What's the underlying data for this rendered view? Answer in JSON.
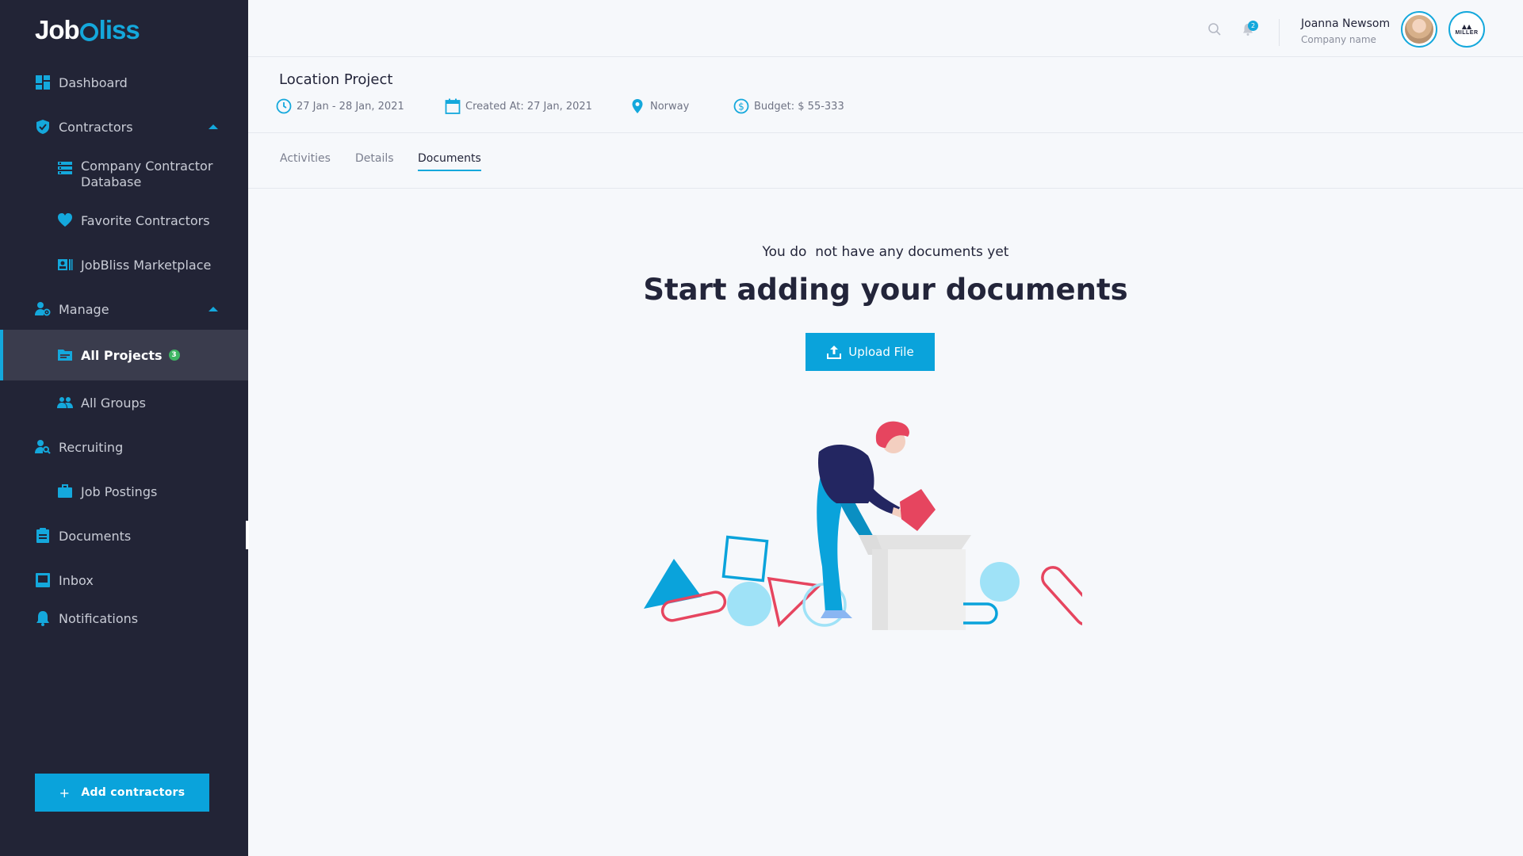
{
  "brand": {
    "name_part1": "Job",
    "name_part2": "liss"
  },
  "sidebar": {
    "items": [
      {
        "label": "Dashboard",
        "icon": "dashboard-icon"
      },
      {
        "label": "Contractors",
        "icon": "shield-icon",
        "expanded": true
      },
      {
        "label": "Company Contractor Database",
        "icon": "database-icon"
      },
      {
        "label": "Favorite Contractors",
        "icon": "heart-icon"
      },
      {
        "label": "JobBliss Marketplace",
        "icon": "id-card-icon"
      },
      {
        "label": "Manage",
        "icon": "user-gear-icon",
        "expanded": true
      },
      {
        "label": "All Projects",
        "icon": "folder-icon",
        "badge": "3",
        "active": true
      },
      {
        "label": "All Groups",
        "icon": "group-icon"
      },
      {
        "label": "Recruiting",
        "icon": "user-search-icon"
      },
      {
        "label": "Job Postings",
        "icon": "briefcase-icon"
      },
      {
        "label": "Documents",
        "icon": "clipboard-icon"
      },
      {
        "label": "Inbox",
        "icon": "inbox-icon"
      },
      {
        "label": "Notifications",
        "icon": "bell-icon"
      }
    ],
    "add_button": {
      "plus": "+",
      "label": "Add contractors"
    }
  },
  "header": {
    "notification_count": "2",
    "user_name": "Joanna Newsom",
    "company_name": "Company name",
    "company_logo_text": "MILLER"
  },
  "project": {
    "title": "Location Project",
    "dates": "27 Jan - 28 Jan, 2021",
    "created": "Created At: 27 Jan, 2021",
    "location": "Norway",
    "budget": "Budget: $ 55-333"
  },
  "tabs": [
    {
      "label": "Activities"
    },
    {
      "label": "Details"
    },
    {
      "label": "Documents",
      "active": true
    }
  ],
  "empty_state": {
    "subtitle": "You do  not have any documents yet",
    "title": "Start adding your documents",
    "button": "Upload File"
  },
  "colors": {
    "accent": "#0aa3db",
    "sidebar_bg": "#222436",
    "active_bg": "#3a3c4d",
    "badge_green": "#3fb563",
    "illustration_pink": "#e6455f",
    "illustration_navy": "#232661"
  }
}
